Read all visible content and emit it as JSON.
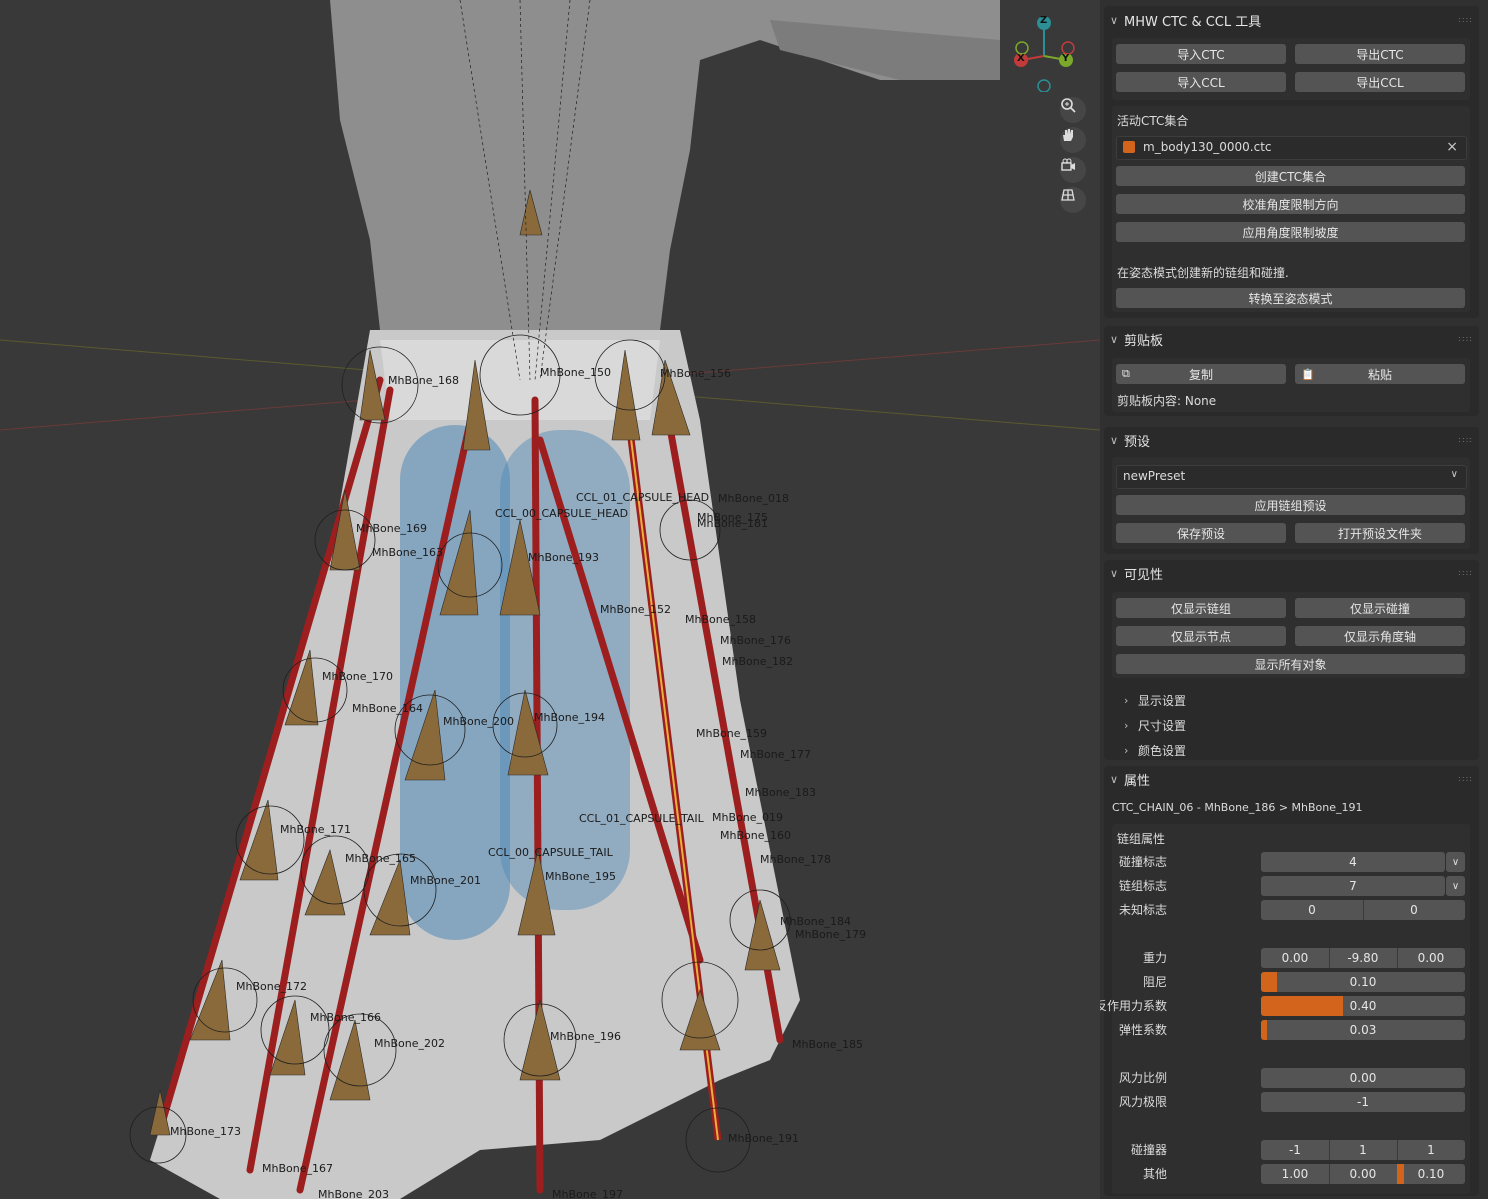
{
  "viewport": {
    "bone_labels": [
      "MhBone_168",
      "MhBone_150",
      "MhBone_156",
      "MhBone_169",
      "MhBone_163",
      "MhBone_193",
      "MhBone_152",
      "MhBone_170",
      "MhBone_164",
      "MhBone_200",
      "MhBone_194",
      "MhBone_171",
      "MhBone_165",
      "MhBone_201",
      "MhBone_195",
      "MhBone_172",
      "MhBone_166",
      "MhBone_202",
      "MhBone_196",
      "MhBone_173",
      "MhBone_167",
      "MhBone_203",
      "MhBone_197",
      "MhBone_191",
      "MhBone_185",
      "MhBone_179",
      "MhBone_184",
      "MhBone_178",
      "MhBone_177",
      "MhBone_183",
      "MhBone_176",
      "MhBone_182",
      "MhBone_158",
      "MhBone_175",
      "MhBone_181",
      "MhBone_018",
      "MhBone_160",
      "MhBone_019",
      "MhBone_159"
    ],
    "capsule_labels": [
      "CCL_01_CAPSULE_HEAD",
      "CCL_00_CAPSULE_HEAD",
      "CCL_01_CAPSULE_TAIL",
      "CCL_00_CAPSULE_TAIL"
    ],
    "gizmo": {
      "z": "Z",
      "x": "X",
      "y": "Y"
    }
  },
  "panel": {
    "title": "MHW CTC & CCL 工具",
    "import_ctc": "导入CTC",
    "export_ctc": "导出CTC",
    "import_ccl": "导入CCL",
    "export_ccl": "导出CCL",
    "active_ctc_label": "活动CTC集合",
    "active_ctc_value": "m_body130_0000.ctc",
    "create_ctc": "创建CTC集合",
    "calibrate": "校准角度限制方向",
    "apply_slope": "应用角度限制坡度",
    "pose_hint": "在姿态模式创建新的链组和碰撞.",
    "to_pose_mode": "转换至姿态模式",
    "clipboard_title": "剪贴板",
    "copy": "复制",
    "paste": "粘贴",
    "clipboard_content": "剪贴板内容: None",
    "preset_title": "预设",
    "preset_value": "newPreset",
    "apply_chain_preset": "应用链组预设",
    "save_preset": "保存预设",
    "open_preset_folder": "打开预设文件夹",
    "visibility_title": "可见性",
    "show_chains": "仅显示链组",
    "show_collisions": "仅显示碰撞",
    "show_nodes": "仅显示节点",
    "show_axes": "仅显示角度轴",
    "show_all": "显示所有对象",
    "display_settings": "显示设置",
    "size_settings": "尺寸设置",
    "color_settings": "颜色设置",
    "props_title": "属性",
    "chain_path": "CTC_CHAIN_06 - MhBone_186 > MhBone_191",
    "chain_props_label": "链组属性",
    "collision_flag_label": "碰撞标志",
    "collision_flag": "4",
    "chain_flag_label": "链组标志",
    "chain_flag": "7",
    "unknown_flag_label": "未知标志",
    "unknown_flag": [
      "0",
      "0"
    ],
    "gravity_label": "重力",
    "gravity": [
      "0.00",
      "-9.80",
      "0.00"
    ],
    "damping_label": "阻尼",
    "damping": "0.10",
    "damping_frac": 0.08,
    "reaction_label": "反作用力系数",
    "reaction": "0.40",
    "reaction_frac": 0.4,
    "elasticity_label": "弹性系数",
    "elasticity": "0.03",
    "elasticity_frac": 0.03,
    "wind_ratio_label": "风力比例",
    "wind_ratio": "0.00",
    "wind_limit_label": "风力极限",
    "wind_limit": "-1",
    "collider_label": "碰撞器",
    "collider": [
      "-1",
      "1",
      "1"
    ],
    "other_label": "其他",
    "other": [
      "1.00",
      "0.00",
      "0.10"
    ],
    "other_frac": 0.1
  },
  "colors": {
    "accent": "#d2641b",
    "bone_red": "#9c1e1e",
    "selected": "#e8b23a",
    "capsule": "#4e88b8"
  }
}
